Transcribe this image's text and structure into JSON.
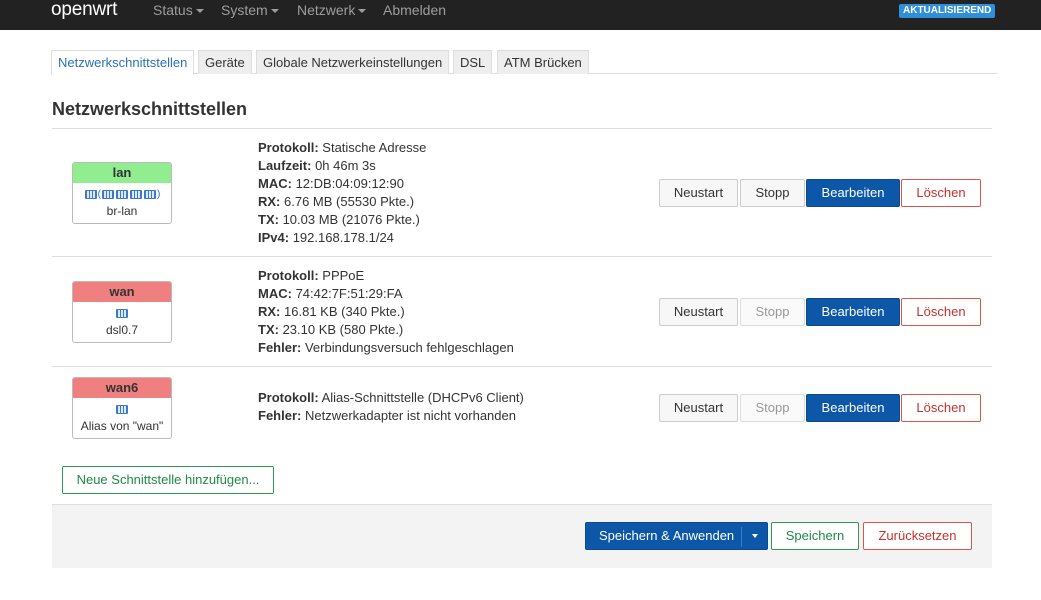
{
  "navbar": {
    "brand": "openwrt",
    "menu": [
      "Status",
      "System",
      "Netzwerk",
      "Abmelden"
    ],
    "badge": "AKTUALISIEREND"
  },
  "tabs": [
    "Netzwerkschnittstellen",
    "Geräte",
    "Globale Netzwerkeinstellungen",
    "DSL",
    "ATM Brücken"
  ],
  "page_title": "Netzwerkschnittstellen",
  "interfaces": [
    {
      "name": "lan",
      "header_color": "#90ee90",
      "icons": "🖧(🖧🖧🖧🖧)",
      "device": "br-lan",
      "info": [
        {
          "label": "Protokoll:",
          "value": "Statische Adresse"
        },
        {
          "label": "Laufzeit:",
          "value": "0h 46m 3s"
        },
        {
          "label": "MAC:",
          "value": "12:DB:04:09:12:90"
        },
        {
          "label": "RX:",
          "value": "6.76 MB (55530 Pkte.)"
        },
        {
          "label": "TX:",
          "value": "10.03 MB (21076 Pkte.)"
        },
        {
          "label": "IPv4:",
          "value": "192.168.178.1/24"
        }
      ]
    },
    {
      "name": "wan",
      "header_color": "#f08080",
      "icons": "🖧",
      "device": "dsl0.7",
      "info": [
        {
          "label": "Protokoll:",
          "value": "PPPoE"
        },
        {
          "label": "MAC:",
          "value": "74:42:7F:51:29:FA"
        },
        {
          "label": "RX:",
          "value": "16.81 KB (340 Pkte.)"
        },
        {
          "label": "TX:",
          "value": "23.10 KB (580 Pkte.)"
        },
        {
          "label": "Fehler:",
          "value": "Verbindungsversuch fehlgeschlagen"
        }
      ]
    },
    {
      "name": "wan6",
      "header_color": "#f08080",
      "icons": "🖧",
      "device": "Alias von \"wan\"",
      "info": [
        {
          "label": "Protokoll:",
          "value": "Alias-Schnittstelle (DHCPv6 Client)"
        },
        {
          "label": "Fehler:",
          "value": "Netzwerkadapter ist nicht vorhanden"
        }
      ]
    }
  ],
  "row_buttons": {
    "restart": "Neustart",
    "stop": "Stopp",
    "edit": "Bearbeiten",
    "delete": "Löschen"
  },
  "add_interface": "Neue Schnittstelle hinzufügen...",
  "footer": {
    "save_apply": "Speichern & Anwenden",
    "save": "Speichern",
    "reset": "Zurücksetzen"
  },
  "colors": {
    "navbar": "#222222",
    "primary": "#0d57a8",
    "danger": "#c9302c",
    "success": "#1f8a46",
    "lan_header": "#90ee90",
    "wan_header": "#f08080"
  }
}
